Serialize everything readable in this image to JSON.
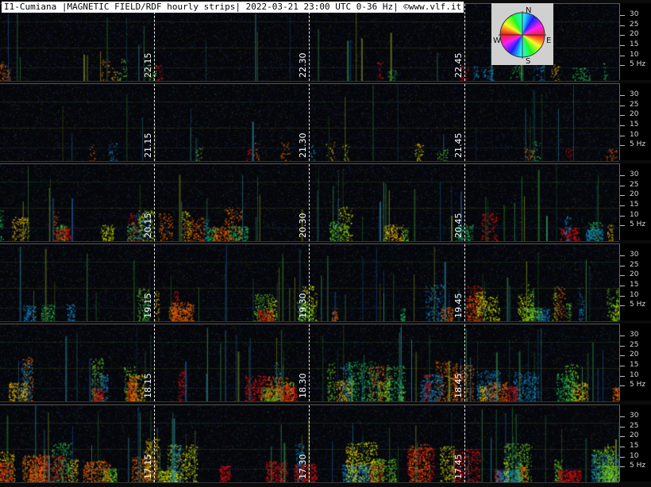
{
  "title": "I1-Cumiana |MAGNETIC FIELD/RDF hourly strips| 2022-03-21 23:00 UTC 0-36 Hz| ©www.vlf.it",
  "compass": {
    "north": "N",
    "south": "S",
    "east": "E",
    "west": "W"
  },
  "frequency_scale": {
    "ticks": [
      "30",
      "25",
      "20",
      "15",
      "10",
      "5 Hz"
    ],
    "range_hz": [
      0,
      36
    ]
  },
  "strips": [
    {
      "time_labels": [
        "22.15",
        "22.30",
        "22.45"
      ],
      "activity": 0.25
    },
    {
      "time_labels": [
        "21.15",
        "21.30",
        "21.45"
      ],
      "activity": 0.2
    },
    {
      "time_labels": [
        "20.15",
        "20.30",
        "20.45"
      ],
      "activity": 0.55
    },
    {
      "time_labels": [
        "19.15",
        "19.30",
        "19.45"
      ],
      "activity": 0.6
    },
    {
      "time_labels": [
        "18.15",
        "18.30",
        "18.45"
      ],
      "activity": 0.75
    },
    {
      "time_labels": [
        "17.15",
        "17.30",
        "17.45"
      ],
      "activity": 0.8
    }
  ]
}
